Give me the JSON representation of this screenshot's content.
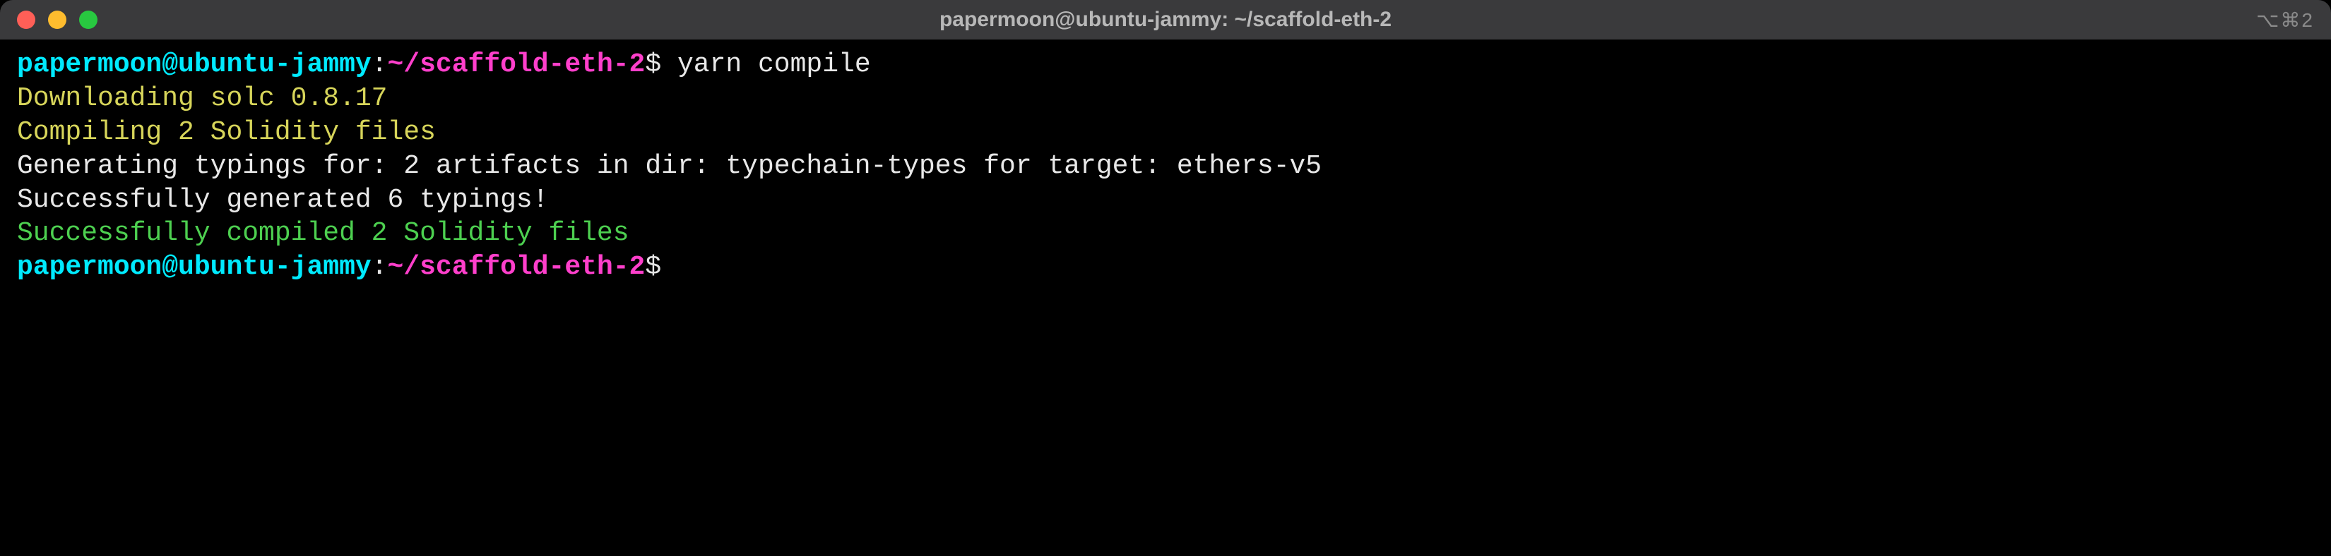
{
  "titleBar": {
    "title": "papermoon@ubuntu-jammy: ~/scaffold-eth-2",
    "rightIndicator": "⌥⌘2"
  },
  "prompt": {
    "user_host": "papermoon@ubuntu-jammy",
    "colon": ":",
    "path": "~/scaffold-eth-2",
    "dollar": "$"
  },
  "lines": {
    "command": "yarn compile",
    "downloading": "Downloading solc 0.8.17",
    "compiling": "Compiling 2 Solidity files",
    "generating": "Generating typings for: 2 artifacts in dir: typechain-types for target: ethers-v5",
    "generated": "Successfully generated 6 typings!",
    "compiled": "Successfully compiled 2 Solidity files"
  }
}
